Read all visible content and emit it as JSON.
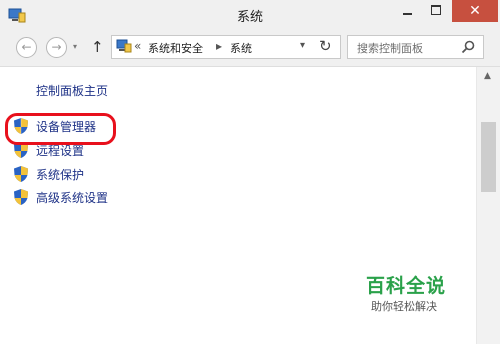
{
  "window": {
    "title": "系统",
    "close_glyph": "✕"
  },
  "nav": {
    "back_glyph": "←",
    "forward_glyph": "→",
    "recent_glyph": "▾",
    "up_glyph": "↑"
  },
  "address": {
    "sep1": "«",
    "crumb1": "系统和安全",
    "sep2": "▸",
    "crumb2": "系统",
    "dropdown_glyph": "▾",
    "refresh_glyph": "↻"
  },
  "search": {
    "placeholder": "搜索控制面板"
  },
  "sidebar": {
    "home_link": "控制面板主页",
    "tasks": [
      {
        "label": "设备管理器",
        "icon": "shield-icon"
      },
      {
        "label": "远程设置",
        "icon": "shield-icon"
      },
      {
        "label": "系统保护",
        "icon": "shield-icon"
      },
      {
        "label": "高级系统设置",
        "icon": "shield-icon"
      }
    ]
  },
  "watermark": {
    "title": "百科全说",
    "subtitle": "助你轻松解决"
  },
  "colors": {
    "link": "#1e3287",
    "highlight": "#e8101c",
    "close_button": "#c7503f",
    "watermark": "#2aa14a"
  }
}
